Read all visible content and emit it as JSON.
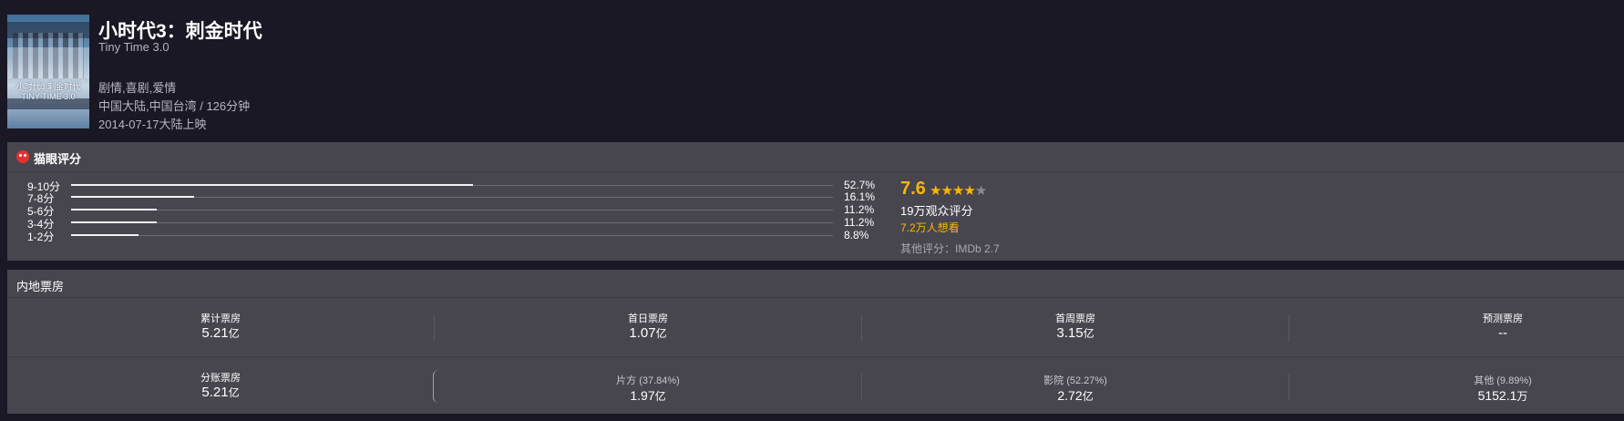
{
  "movie": {
    "title": "小时代3：刺金时代",
    "title_en": "Tiny Time 3.0",
    "genres": "剧情,喜剧,爱情",
    "region_duration": "中国大陆,中国台湾 / 126分钟",
    "release": "2014-07-17大陆上映",
    "poster_text": "小时代3:刺金时代 TINY TIME 3.0"
  },
  "rating": {
    "section_label": "猫眼评分",
    "distribution": [
      {
        "label": "9-10分",
        "percent": 52.7,
        "percent_text": "52.7%"
      },
      {
        "label": "7-8分",
        "percent": 16.1,
        "percent_text": "16.1%"
      },
      {
        "label": "5-6分",
        "percent": 11.2,
        "percent_text": "11.2%"
      },
      {
        "label": "3-4分",
        "percent": 11.2,
        "percent_text": "11.2%"
      },
      {
        "label": "1-2分",
        "percent": 8.8,
        "percent_text": "8.8%"
      }
    ],
    "score": "7.6",
    "stars_full": 4,
    "stars_total": 5,
    "rater_count": "19万观众评分",
    "want_count": "7.2万人想看",
    "other_score": "其他评分：IMDb 2.7"
  },
  "box_office": {
    "section_label": "内地票房",
    "row1": [
      {
        "label": "累计票房",
        "value": "5.21",
        "unit": "亿"
      },
      {
        "label": "首日票房",
        "value": "1.07",
        "unit": "亿"
      },
      {
        "label": "首周票房",
        "value": "3.15",
        "unit": "亿"
      },
      {
        "label": "预测票房",
        "value": "--",
        "unit": ""
      }
    ],
    "row2": [
      {
        "label": "分账票房",
        "value": "5.21",
        "unit": "亿"
      },
      {
        "label": "片方 (37.84%)",
        "value": "1.97",
        "unit": "亿"
      },
      {
        "label": "影院 (52.27%)",
        "value": "2.72",
        "unit": "亿"
      },
      {
        "label": "其他 (9.89%)",
        "value": "5152.1",
        "unit": "万"
      }
    ]
  },
  "colors": {
    "background": "#1a1824",
    "panel": "#47464f",
    "accent": "#ffb400",
    "brand_red": "#e2332f"
  }
}
